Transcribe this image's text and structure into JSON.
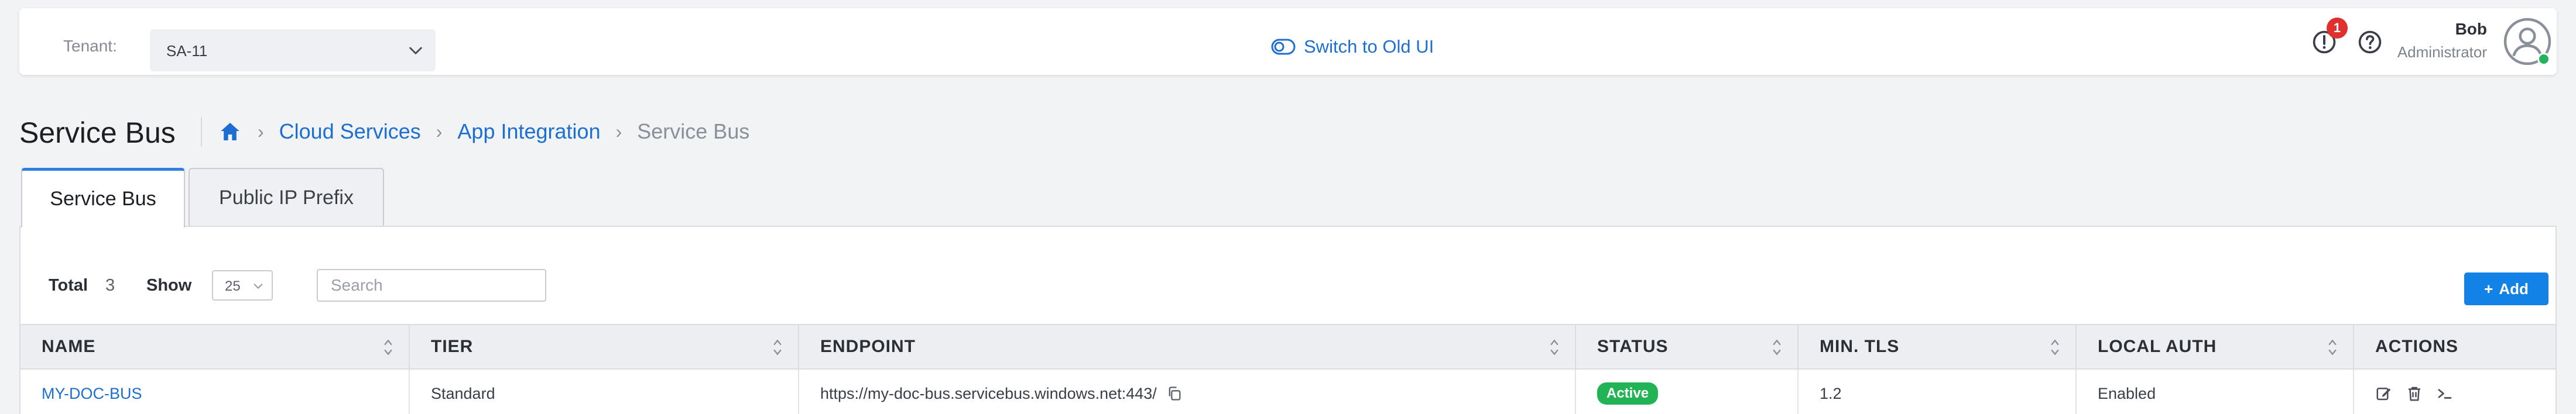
{
  "header": {
    "tenant_label": "Tenant:",
    "tenant_value": "SA-11",
    "switch_label": "Switch to Old UI",
    "notification_count": "1",
    "user_name": "Bob",
    "user_role": "Administrator"
  },
  "page": {
    "title": "Service Bus",
    "breadcrumb": [
      "Cloud Services",
      "App Integration",
      "Service Bus"
    ]
  },
  "tabs": [
    {
      "label": "Service Bus",
      "active": true
    },
    {
      "label": "Public IP Prefix",
      "active": false
    }
  ],
  "toolbar": {
    "total_label": "Total",
    "total_value": "3",
    "show_label": "Show",
    "page_size": "25",
    "search_placeholder": "Search",
    "add_label": "Add"
  },
  "table": {
    "columns": [
      "NAME",
      "TIER",
      "ENDPOINT",
      "STATUS",
      "MIN. TLS",
      "LOCAL AUTH",
      "ACTIONS"
    ],
    "rows": [
      {
        "name": "MY-DOC-BUS",
        "tier": "Standard",
        "endpoint": "https://my-doc-bus.servicebus.windows.net:443/",
        "status": "Active",
        "min_tls": "1.2",
        "local_auth": "Enabled"
      }
    ]
  },
  "colors": {
    "accent": "#1c6fd1",
    "primary_button": "#1282e6",
    "status_active": "#21b354",
    "badge_red": "#e02f2f"
  }
}
